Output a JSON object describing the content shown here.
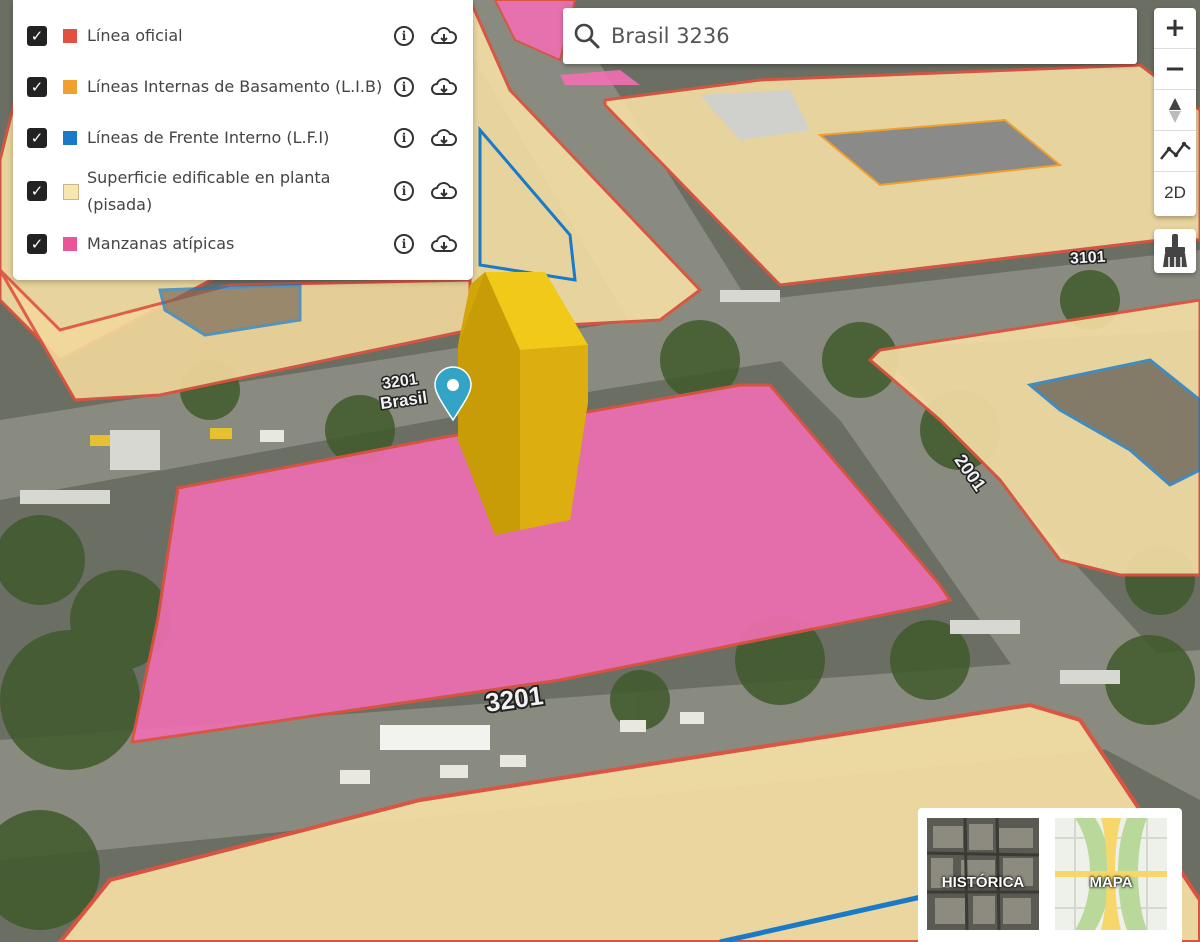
{
  "layers": [
    {
      "label": "Línea oficial",
      "color": "#e0523f",
      "checked": true
    },
    {
      "label": "Líneas Internas de Basamento (L.I.B)",
      "color": "#f0a030",
      "checked": true
    },
    {
      "label": "Líneas de Frente Interno (L.F.I)",
      "color": "#1a7ac8",
      "checked": true
    },
    {
      "label": "Superficie edificable en planta (pisada)",
      "color": "#f7e6ae",
      "checked": true
    },
    {
      "label": "Manzanas atípicas",
      "color": "#e9559a",
      "checked": true
    }
  ],
  "search": {
    "value": "Brasil 3236"
  },
  "controls": {
    "zoom_in": "+",
    "zoom_out": "−",
    "mode_2d": "2D"
  },
  "street_labels": {
    "front": "3201",
    "back": "3201",
    "right_back": "3101",
    "right": "2001",
    "street_name": "Brasil"
  },
  "basemaps": [
    {
      "label": "HISTÓRICA",
      "icon": "historic-aerial-thumbnail"
    },
    {
      "label": "MAPA",
      "icon": "street-map-thumbnail"
    }
  ]
}
